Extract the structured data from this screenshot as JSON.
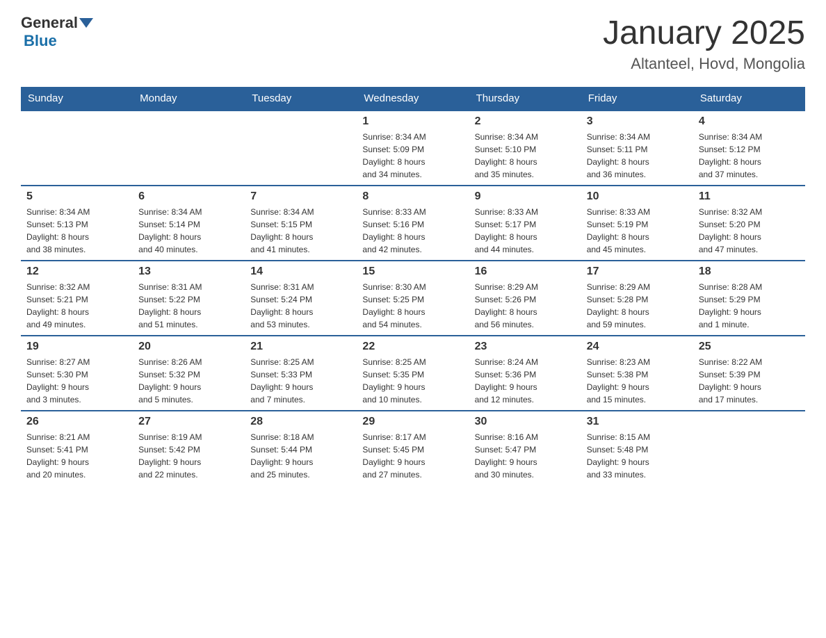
{
  "header": {
    "logo_general": "General",
    "logo_blue": "Blue",
    "title": "January 2025",
    "subtitle": "Altanteel, Hovd, Mongolia"
  },
  "weekdays": [
    "Sunday",
    "Monday",
    "Tuesday",
    "Wednesday",
    "Thursday",
    "Friday",
    "Saturday"
  ],
  "weeks": [
    [
      {
        "day": "",
        "info": ""
      },
      {
        "day": "",
        "info": ""
      },
      {
        "day": "",
        "info": ""
      },
      {
        "day": "1",
        "info": "Sunrise: 8:34 AM\nSunset: 5:09 PM\nDaylight: 8 hours\nand 34 minutes."
      },
      {
        "day": "2",
        "info": "Sunrise: 8:34 AM\nSunset: 5:10 PM\nDaylight: 8 hours\nand 35 minutes."
      },
      {
        "day": "3",
        "info": "Sunrise: 8:34 AM\nSunset: 5:11 PM\nDaylight: 8 hours\nand 36 minutes."
      },
      {
        "day": "4",
        "info": "Sunrise: 8:34 AM\nSunset: 5:12 PM\nDaylight: 8 hours\nand 37 minutes."
      }
    ],
    [
      {
        "day": "5",
        "info": "Sunrise: 8:34 AM\nSunset: 5:13 PM\nDaylight: 8 hours\nand 38 minutes."
      },
      {
        "day": "6",
        "info": "Sunrise: 8:34 AM\nSunset: 5:14 PM\nDaylight: 8 hours\nand 40 minutes."
      },
      {
        "day": "7",
        "info": "Sunrise: 8:34 AM\nSunset: 5:15 PM\nDaylight: 8 hours\nand 41 minutes."
      },
      {
        "day": "8",
        "info": "Sunrise: 8:33 AM\nSunset: 5:16 PM\nDaylight: 8 hours\nand 42 minutes."
      },
      {
        "day": "9",
        "info": "Sunrise: 8:33 AM\nSunset: 5:17 PM\nDaylight: 8 hours\nand 44 minutes."
      },
      {
        "day": "10",
        "info": "Sunrise: 8:33 AM\nSunset: 5:19 PM\nDaylight: 8 hours\nand 45 minutes."
      },
      {
        "day": "11",
        "info": "Sunrise: 8:32 AM\nSunset: 5:20 PM\nDaylight: 8 hours\nand 47 minutes."
      }
    ],
    [
      {
        "day": "12",
        "info": "Sunrise: 8:32 AM\nSunset: 5:21 PM\nDaylight: 8 hours\nand 49 minutes."
      },
      {
        "day": "13",
        "info": "Sunrise: 8:31 AM\nSunset: 5:22 PM\nDaylight: 8 hours\nand 51 minutes."
      },
      {
        "day": "14",
        "info": "Sunrise: 8:31 AM\nSunset: 5:24 PM\nDaylight: 8 hours\nand 53 minutes."
      },
      {
        "day": "15",
        "info": "Sunrise: 8:30 AM\nSunset: 5:25 PM\nDaylight: 8 hours\nand 54 minutes."
      },
      {
        "day": "16",
        "info": "Sunrise: 8:29 AM\nSunset: 5:26 PM\nDaylight: 8 hours\nand 56 minutes."
      },
      {
        "day": "17",
        "info": "Sunrise: 8:29 AM\nSunset: 5:28 PM\nDaylight: 8 hours\nand 59 minutes."
      },
      {
        "day": "18",
        "info": "Sunrise: 8:28 AM\nSunset: 5:29 PM\nDaylight: 9 hours\nand 1 minute."
      }
    ],
    [
      {
        "day": "19",
        "info": "Sunrise: 8:27 AM\nSunset: 5:30 PM\nDaylight: 9 hours\nand 3 minutes."
      },
      {
        "day": "20",
        "info": "Sunrise: 8:26 AM\nSunset: 5:32 PM\nDaylight: 9 hours\nand 5 minutes."
      },
      {
        "day": "21",
        "info": "Sunrise: 8:25 AM\nSunset: 5:33 PM\nDaylight: 9 hours\nand 7 minutes."
      },
      {
        "day": "22",
        "info": "Sunrise: 8:25 AM\nSunset: 5:35 PM\nDaylight: 9 hours\nand 10 minutes."
      },
      {
        "day": "23",
        "info": "Sunrise: 8:24 AM\nSunset: 5:36 PM\nDaylight: 9 hours\nand 12 minutes."
      },
      {
        "day": "24",
        "info": "Sunrise: 8:23 AM\nSunset: 5:38 PM\nDaylight: 9 hours\nand 15 minutes."
      },
      {
        "day": "25",
        "info": "Sunrise: 8:22 AM\nSunset: 5:39 PM\nDaylight: 9 hours\nand 17 minutes."
      }
    ],
    [
      {
        "day": "26",
        "info": "Sunrise: 8:21 AM\nSunset: 5:41 PM\nDaylight: 9 hours\nand 20 minutes."
      },
      {
        "day": "27",
        "info": "Sunrise: 8:19 AM\nSunset: 5:42 PM\nDaylight: 9 hours\nand 22 minutes."
      },
      {
        "day": "28",
        "info": "Sunrise: 8:18 AM\nSunset: 5:44 PM\nDaylight: 9 hours\nand 25 minutes."
      },
      {
        "day": "29",
        "info": "Sunrise: 8:17 AM\nSunset: 5:45 PM\nDaylight: 9 hours\nand 27 minutes."
      },
      {
        "day": "30",
        "info": "Sunrise: 8:16 AM\nSunset: 5:47 PM\nDaylight: 9 hours\nand 30 minutes."
      },
      {
        "day": "31",
        "info": "Sunrise: 8:15 AM\nSunset: 5:48 PM\nDaylight: 9 hours\nand 33 minutes."
      },
      {
        "day": "",
        "info": ""
      }
    ]
  ]
}
